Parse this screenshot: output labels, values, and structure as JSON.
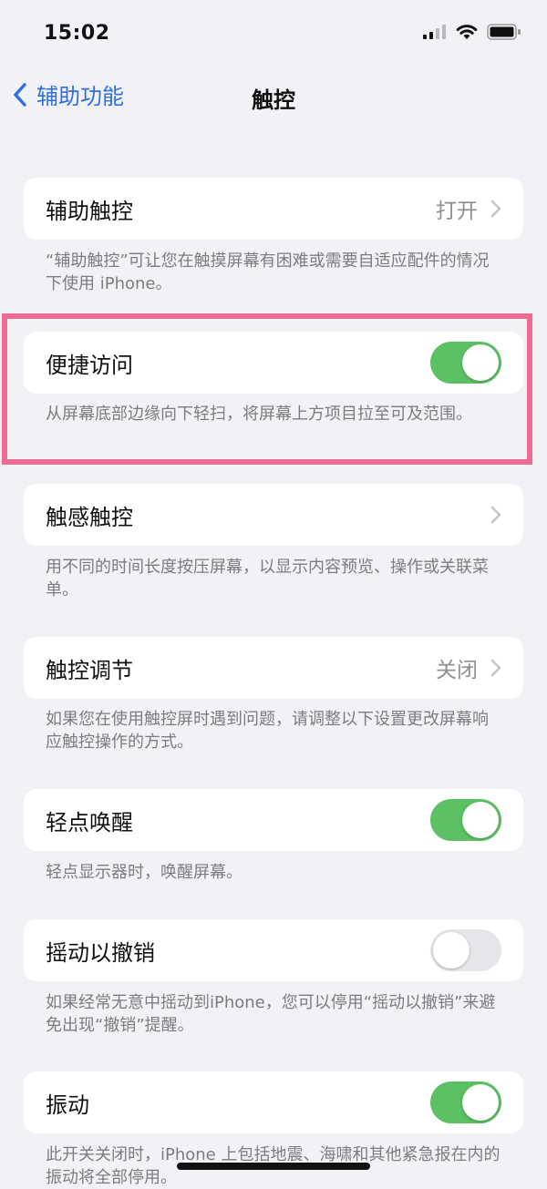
{
  "status_bar": {
    "time": "15:02",
    "icons": [
      "signal-icon",
      "wifi-icon",
      "battery-icon"
    ]
  },
  "nav": {
    "back_label": "辅助功能",
    "title": "触控"
  },
  "colors": {
    "accent": "#2f6fe0",
    "toggle_on": "#5cc065",
    "toggle_off": "#e6e6ea",
    "highlight": "#ec6b94",
    "background": "#f2f2f6"
  },
  "rows": [
    {
      "label": "辅助触控",
      "value": "打开",
      "control": "chevron",
      "footnote": "“辅助触控”可让您在触摸屏幕有困难或需要自适应配件的情况下使用 iPhone。"
    },
    {
      "label": "便捷访问",
      "control": "toggle",
      "on": true,
      "footnote": "从屏幕底部边缘向下轻扫，将屏幕上方项目拉至可及范围。"
    },
    {
      "label": "触感触控",
      "control": "chevron",
      "footnote": "用不同的时间长度按压屏幕，以显示内容预览、操作或关联菜单。"
    },
    {
      "label": "触控调节",
      "value": "关闭",
      "control": "chevron",
      "footnote": "如果您在使用触控屏时遇到问题，请调整以下设置更改屏幕响应触控操作的方式。"
    },
    {
      "label": "轻点唤醒",
      "control": "toggle",
      "on": true,
      "footnote": "轻点显示器时，唤醒屏幕。"
    },
    {
      "label": "摇动以撤销",
      "control": "toggle",
      "on": false,
      "footnote": "如果经常无意中摇动到iPhone，您可以停用“摇动以撤销”来避免出现“撤销”提醒。"
    },
    {
      "label": "振动",
      "control": "toggle",
      "on": true,
      "footnote": "此开关关闭时，iPhone 上包括地震、海啸和其他紧急报在内的振动将全部停用。"
    }
  ]
}
